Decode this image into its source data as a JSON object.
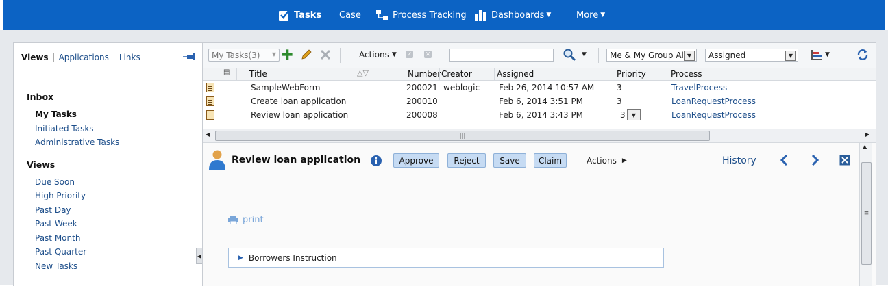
{
  "top_nav": {
    "tasks": "Tasks",
    "case": "Case",
    "process_tracking": "Process Tracking",
    "dashboards": "Dashboards",
    "more": "More"
  },
  "left_panel": {
    "tabs": [
      "Views",
      "Applications",
      "Links"
    ],
    "inbox_heading": "Inbox",
    "inbox_items": [
      "My Tasks",
      "Initiated Tasks",
      "Administrative Tasks"
    ],
    "views_heading": "Views",
    "view_items": [
      "Due Soon",
      "High Priority",
      "Past Day",
      "Past Week",
      "Past Month",
      "Past Quarter",
      "New Tasks"
    ]
  },
  "toolbar": {
    "my_tasks": "My Tasks(3)",
    "actions": "Actions",
    "search_value": "",
    "filter_group": "Me & My Group All",
    "filter_state": "Assigned"
  },
  "table": {
    "columns": [
      "Title",
      "Number",
      "Creator",
      "Assigned",
      "Priority",
      "Process"
    ],
    "rows": [
      {
        "title": "SampleWebForm",
        "number": "200021",
        "creator": "weblogic",
        "assigned": "Feb 26, 2014 10:57 AM",
        "priority": "3",
        "process": "TravelProcess"
      },
      {
        "title": "Create loan application",
        "number": "200010",
        "creator": "",
        "assigned": "Feb 6, 2014 3:51 PM",
        "priority": "3",
        "process": "LoanRequestProcess"
      },
      {
        "title": "Review loan application",
        "number": "200008",
        "creator": "",
        "assigned": "Feb 6, 2014 3:43 PM",
        "priority": "3",
        "process": "LoanRequestProcess"
      }
    ]
  },
  "detail": {
    "title": "Review loan application",
    "buttons": {
      "approve": "Approve",
      "reject": "Reject",
      "save": "Save",
      "claim": "Claim"
    },
    "actions": "Actions",
    "history": "History",
    "print": "print",
    "section": "Borrowers Instruction"
  },
  "colors": {
    "nav_blue": "#0c63c4",
    "button_blue": "#c6dbf3",
    "link_blue": "#1d4e8a"
  }
}
